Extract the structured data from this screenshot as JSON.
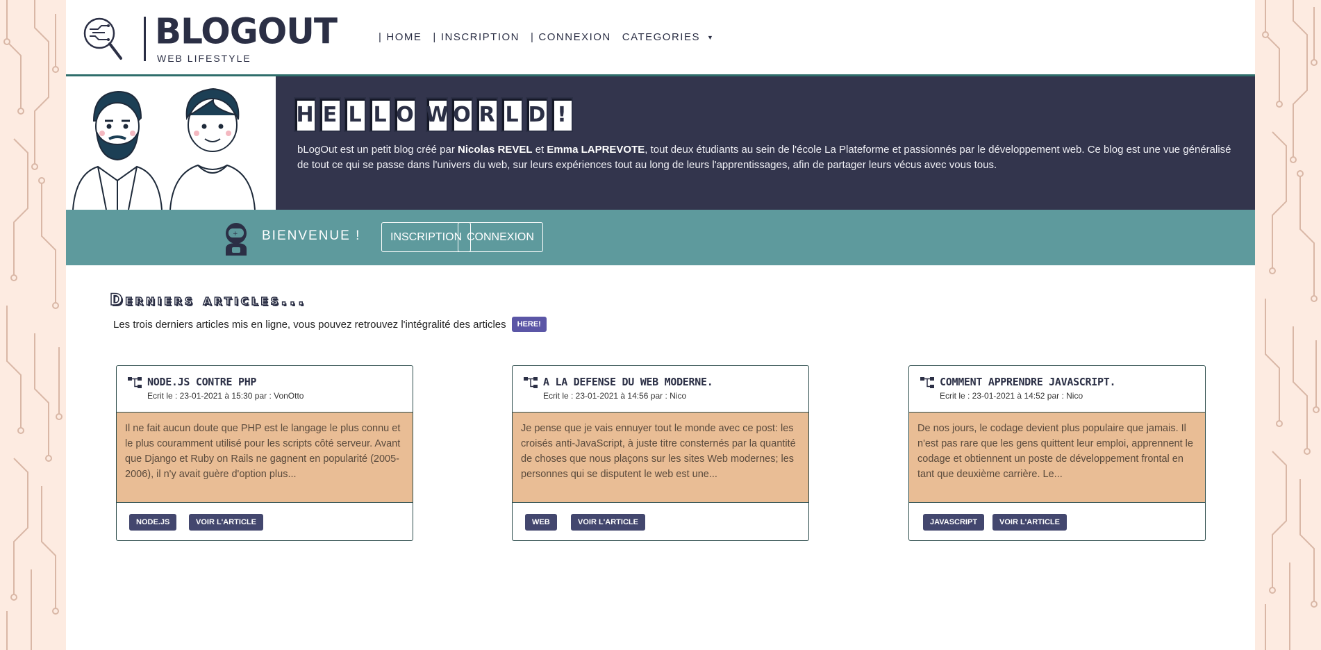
{
  "brand": {
    "title": "BLOGOUT",
    "subtitle": "WEB LIFESTYLE"
  },
  "nav": {
    "items": [
      {
        "label": "HOME"
      },
      {
        "label": "INSCRIPTION"
      },
      {
        "label": "CONNEXION"
      }
    ],
    "categories_label": "CATEGORIES"
  },
  "hero": {
    "title_word1": [
      "H",
      "E",
      "L",
      "L",
      "O"
    ],
    "title_word2": [
      "W",
      "O",
      "R",
      "L",
      "D",
      "!"
    ],
    "text_pre": "bLogOut est un petit blog créé par ",
    "author1": "Nicolas REVEL",
    "text_mid": " et ",
    "author2": "Emma LAPREVOTE",
    "text_post": ", tout deux étudiants au sein de l'école La Plateforme et passionnés par le développement web. Ce blog est une vue généralisé de tout ce qui se passe dans l'univers du web, sur leurs expériences tout au long de leurs l'apprentissages, afin de partager leurs vécus avec vous tous."
  },
  "welcome": {
    "label": "BIENVENUE !",
    "signup_label": "INSCRIPTION",
    "login_label": "CONNEXION"
  },
  "latest": {
    "title": "Derniers articles...",
    "subtitle": "Les trois derniers articles mis en ligne, vous pouvez retrouvez l'intégralité des articles",
    "here_label": "HERE!"
  },
  "articles": [
    {
      "title": "NODE.JS CONTRE PHP",
      "meta": "Ecrit le : 23-01-2021 à 15:30 par : VonOtto",
      "excerpt": "Il ne fait aucun doute que PHP est le langage le plus connu et le plus couramment utilisé pour les scripts côté serveur. Avant que Django et Ruby on Rails ne gagnent en popularité (2005-2006), il n'y avait guère d'option plus...",
      "tag": "NODE.JS",
      "read_label": "VOIR L'ARTICLE"
    },
    {
      "title": "A LA DEFENSE DU WEB MODERNE.",
      "meta": "Ecrit le : 23-01-2021 à 14:56 par : Nico",
      "excerpt": "Je pense que je vais ennuyer tout le monde avec ce post: les croisés anti-JavaScript, à juste titre consternés par la quantité de choses que nous plaçons sur les sites Web modernes; les personnes qui se disputent le web est une...",
      "tag": "WEB",
      "read_label": "VOIR L'ARTICLE"
    },
    {
      "title": "COMMENT APPRENDRE JAVASCRIPT.",
      "meta": "Ecrit le : 23-01-2021 à 14:52 par : Nico",
      "excerpt": "De nos jours, le codage devient plus populaire que jamais. Il n'est pas rare que les gens quittent leur emploi, apprennent le codage et obtiennent un poste de développement frontal en tant que deuxième carrière. Le...",
      "tag": "JAVASCRIPT",
      "read_label": "VOIR L'ARTICLE"
    }
  ]
}
